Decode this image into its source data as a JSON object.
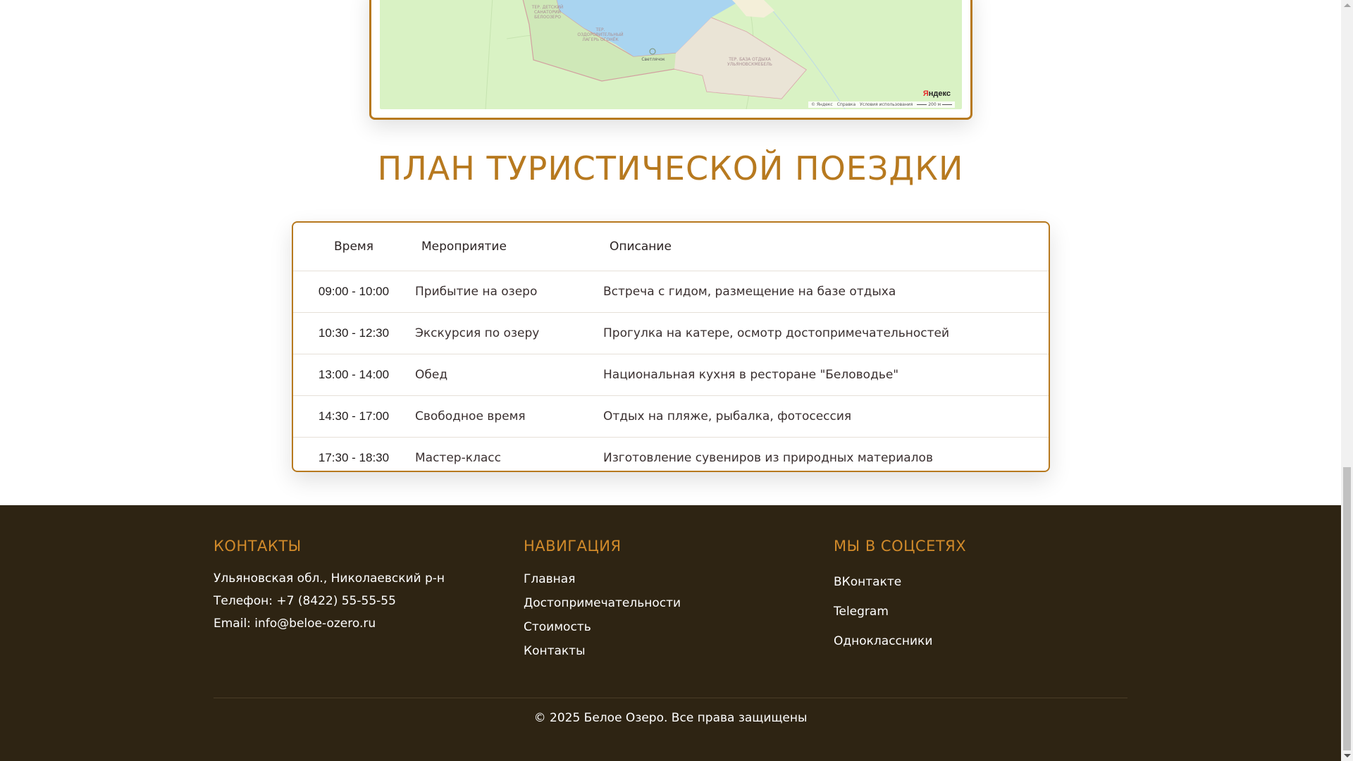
{
  "map": {
    "labels": [
      {
        "text": "ТЕР. ДЕТСКИЙ САНАТОРИЙ БЕЛООЗЕРО",
        "name": "map-label-sanatorium"
      },
      {
        "text": "ТЕР. ОЗДОРОВИТЕЛЬНЫЙ ЛАГЕРЬ ОГОНЁК",
        "name": "map-label-camp"
      },
      {
        "text": "Светлячок",
        "name": "map-label-svetlyachok"
      },
      {
        "text": "ТЕР. БАЗА ОТДЫХА УЛЬЯНОВСКМЕБЕЛЬ",
        "name": "map-label-base"
      }
    ],
    "logo_y": "Я",
    "logo_rest": "ндекс",
    "credit_copyright": "© Яндекс",
    "credit_help": "Справка",
    "credit_terms": "Условия использования",
    "scale_text": "200 м"
  },
  "plan": {
    "title": "ПЛАН ТУРИСТИЧЕСКОЙ ПОЕЗДКИ",
    "headers": {
      "time": "Время",
      "event": "Мероприятие",
      "description": "Описание"
    },
    "rows": [
      {
        "time": "09:00 - 10:00",
        "event": "Прибытие на озеро",
        "description": "Встреча с гидом, размещение на базе отдыха"
      },
      {
        "time": "10:30 - 12:30",
        "event": "Экскурсия по озеру",
        "description": "Прогулка на катере, осмотр достопримечательностей"
      },
      {
        "time": "13:00 - 14:00",
        "event": "Обед",
        "description": "Национальная кухня в ресторане \"Беловодье\""
      },
      {
        "time": "14:30 - 17:00",
        "event": "Свободное время",
        "description": "Отдых на пляже, рыбалка, фотосессия"
      },
      {
        "time": "17:30 - 18:30",
        "event": "Мастер-класс",
        "description": "Изготовление сувениров из природных материалов"
      }
    ]
  },
  "footer": {
    "contacts": {
      "heading": "КОНТАКТЫ",
      "address": "Ульяновская обл., Николаевский р-н",
      "phone": "Телефон: +7 (8422) 55-55-55",
      "email": "Email: info@beloe-ozero.ru"
    },
    "navigation": {
      "heading": "НАВИГАЦИЯ",
      "links": [
        "Главная",
        "Достопримечательности",
        "Стоимость",
        "Контакты"
      ]
    },
    "social": {
      "heading": "МЫ В СОЦСЕТЯХ",
      "links": [
        "ВКонтакте",
        "Telegram",
        "Одноклассники"
      ]
    },
    "copyright": "© 2025 Белое Озеро. Все права защищены"
  },
  "colors": {
    "accent": "#b7791f",
    "footer_bg": "#2e2413",
    "footer_heading": "#d18a2a",
    "map_land": "#d9f2c4",
    "map_water": "#a9d4f0"
  }
}
